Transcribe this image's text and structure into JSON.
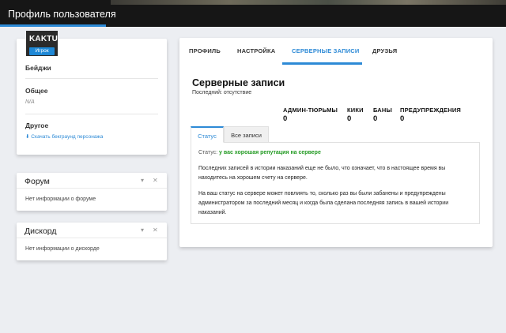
{
  "header": {
    "title": "Профиль пользователя"
  },
  "profile": {
    "nickname": "KAKTU",
    "role_badge": "Игрок",
    "badges_title": "Бейджи",
    "general_title": "Общее",
    "general_value": "N/A",
    "other_title": "Другое",
    "download_link": "Скачать бекграунд персонажа"
  },
  "forum_widget": {
    "title": "Форум",
    "body": "Нет информации о форуме"
  },
  "discord_widget": {
    "title": "Дискорд",
    "body": "Нет информации о дискорде"
  },
  "tabs": [
    "ПРОФИЛЬ",
    "НАСТРОЙКА",
    "СЕРВЕРНЫЕ ЗАПИСИ",
    "ДРУЗЬЯ"
  ],
  "records": {
    "title": "Серверные записи",
    "last": "Последний: отсутствие",
    "stats": [
      {
        "label": "АДМИН-ТЮРЬМЫ",
        "value": "0"
      },
      {
        "label": "КИКИ",
        "value": "0"
      },
      {
        "label": "БАНЫ",
        "value": "0"
      },
      {
        "label": "ПРЕДУПРЕЖДЕНИЯ",
        "value": "0"
      }
    ],
    "subtabs": [
      "Статус",
      "Все записи"
    ],
    "status_label": "Статус:",
    "status_value": "у вас хорошая репутация на сервере",
    "para1": "Последних записей в истории наказаний еще не было, что означает, что в настоящее время вы находитесь на хорошем счету на сервере.",
    "para2": "На ваш статус на сервере может повлиять то, сколько раз вы были забанены и предупреждены администратором за последний месяц и когда была сделана последняя запись в вашей истории наказаний."
  },
  "icons": {
    "download": "download-icon",
    "collapse": "chevron-down-icon",
    "close": "close-icon"
  },
  "colors": {
    "accent": "#2d8ad6",
    "good": "#229a22",
    "header": "#161616"
  }
}
